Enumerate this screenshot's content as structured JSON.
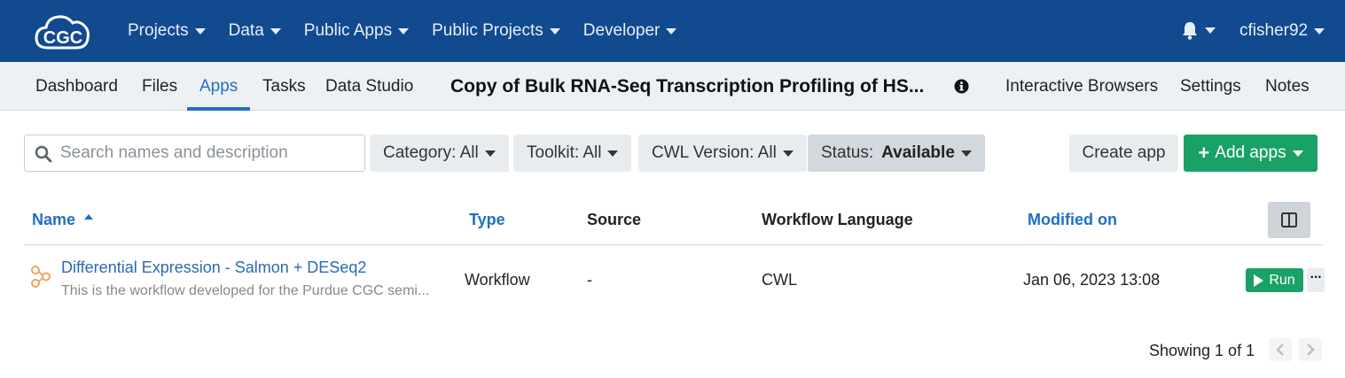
{
  "colors": {
    "topbar": "#114a8f",
    "accent": "#1f6fc4",
    "success": "#1aa166",
    "link": "#2a6bb5",
    "workflow_icon": "#f0a35e"
  },
  "topnav": {
    "logo_icon": "cgc-cloud-logo",
    "items": [
      {
        "label": "Projects"
      },
      {
        "label": "Data"
      },
      {
        "label": "Public Apps"
      },
      {
        "label": "Public Projects"
      },
      {
        "label": "Developer"
      }
    ],
    "bell_icon": "bell-icon",
    "username": "cfisher92"
  },
  "subnav": {
    "left": [
      {
        "label": "Dashboard"
      },
      {
        "label": "Files"
      },
      {
        "label": "Apps"
      },
      {
        "label": "Tasks"
      },
      {
        "label": "Data Studio"
      }
    ],
    "active_tab": "Apps",
    "project_title": "Copy of Bulk RNA-Seq Transcription Profiling of HS...",
    "right": [
      {
        "label": "Interactive Browsers"
      },
      {
        "label": "Settings"
      },
      {
        "label": "Notes"
      }
    ]
  },
  "toolbar": {
    "search_placeholder": "Search names and description",
    "search_value": "",
    "filters": {
      "category": "Category: All",
      "toolkit": "Toolkit: All",
      "cwl_version": "CWL Version: All",
      "status_label": "Status:",
      "status_value": "Available"
    },
    "create_label": "Create app",
    "add_label": "Add apps"
  },
  "table": {
    "headers": {
      "name": "Name",
      "type": "Type",
      "source": "Source",
      "workflow_language": "Workflow Language",
      "modified_on": "Modified on"
    },
    "sort_column": "name",
    "sort_direction": "ascending",
    "rows": [
      {
        "icon": "workflow-icon",
        "name": "Differential Expression - Salmon + DESeq2",
        "description": "This is the workflow developed for the Purdue CGC semi...",
        "type": "Workflow",
        "source": "-",
        "workflow_language": "CWL",
        "modified_on": "Jan 06, 2023 13:08",
        "run_label": "Run",
        "more_label": "···"
      }
    ]
  },
  "pagination": {
    "text": "Showing 1 of 1"
  }
}
